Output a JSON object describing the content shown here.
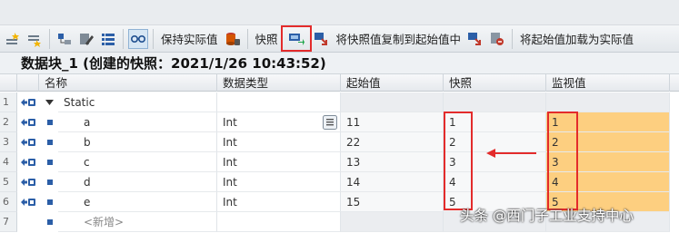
{
  "toolbar": {
    "keep_actual_label": "保持实际值",
    "snapshot_label": "快照",
    "copy_snapshot_label": "将快照值复制到起始值中",
    "load_start_label": "将起始值加载为实际值"
  },
  "title": "数据块_1 (创建的快照：2021/1/26 10:43:52)",
  "columns": {
    "name": "名称",
    "datatype": "数据类型",
    "start": "起始值",
    "snapshot": "快照",
    "monitor": "监视值"
  },
  "rows": [
    {
      "num": "1",
      "name": "Static",
      "type": "",
      "start": "",
      "snapshot": "",
      "monitor": ""
    },
    {
      "num": "2",
      "name": "a",
      "type": "Int",
      "start": "11",
      "snapshot": "1",
      "monitor": "1"
    },
    {
      "num": "3",
      "name": "b",
      "type": "Int",
      "start": "22",
      "snapshot": "2",
      "monitor": "2"
    },
    {
      "num": "4",
      "name": "c",
      "type": "Int",
      "start": "13",
      "snapshot": "3",
      "monitor": "3"
    },
    {
      "num": "5",
      "name": "d",
      "type": "Int",
      "start": "14",
      "snapshot": "4",
      "monitor": "4"
    },
    {
      "num": "6",
      "name": "e",
      "type": "Int",
      "start": "15",
      "snapshot": "5",
      "monitor": "5"
    },
    {
      "num": "7",
      "name": "<新增>",
      "type": "",
      "start": "",
      "snapshot": "",
      "monitor": ""
    }
  ],
  "watermark": "头条 @西门子工业支持中心",
  "colors": {
    "monitor_fill": "#fdcf80",
    "highlight_red": "#e32b2b"
  }
}
